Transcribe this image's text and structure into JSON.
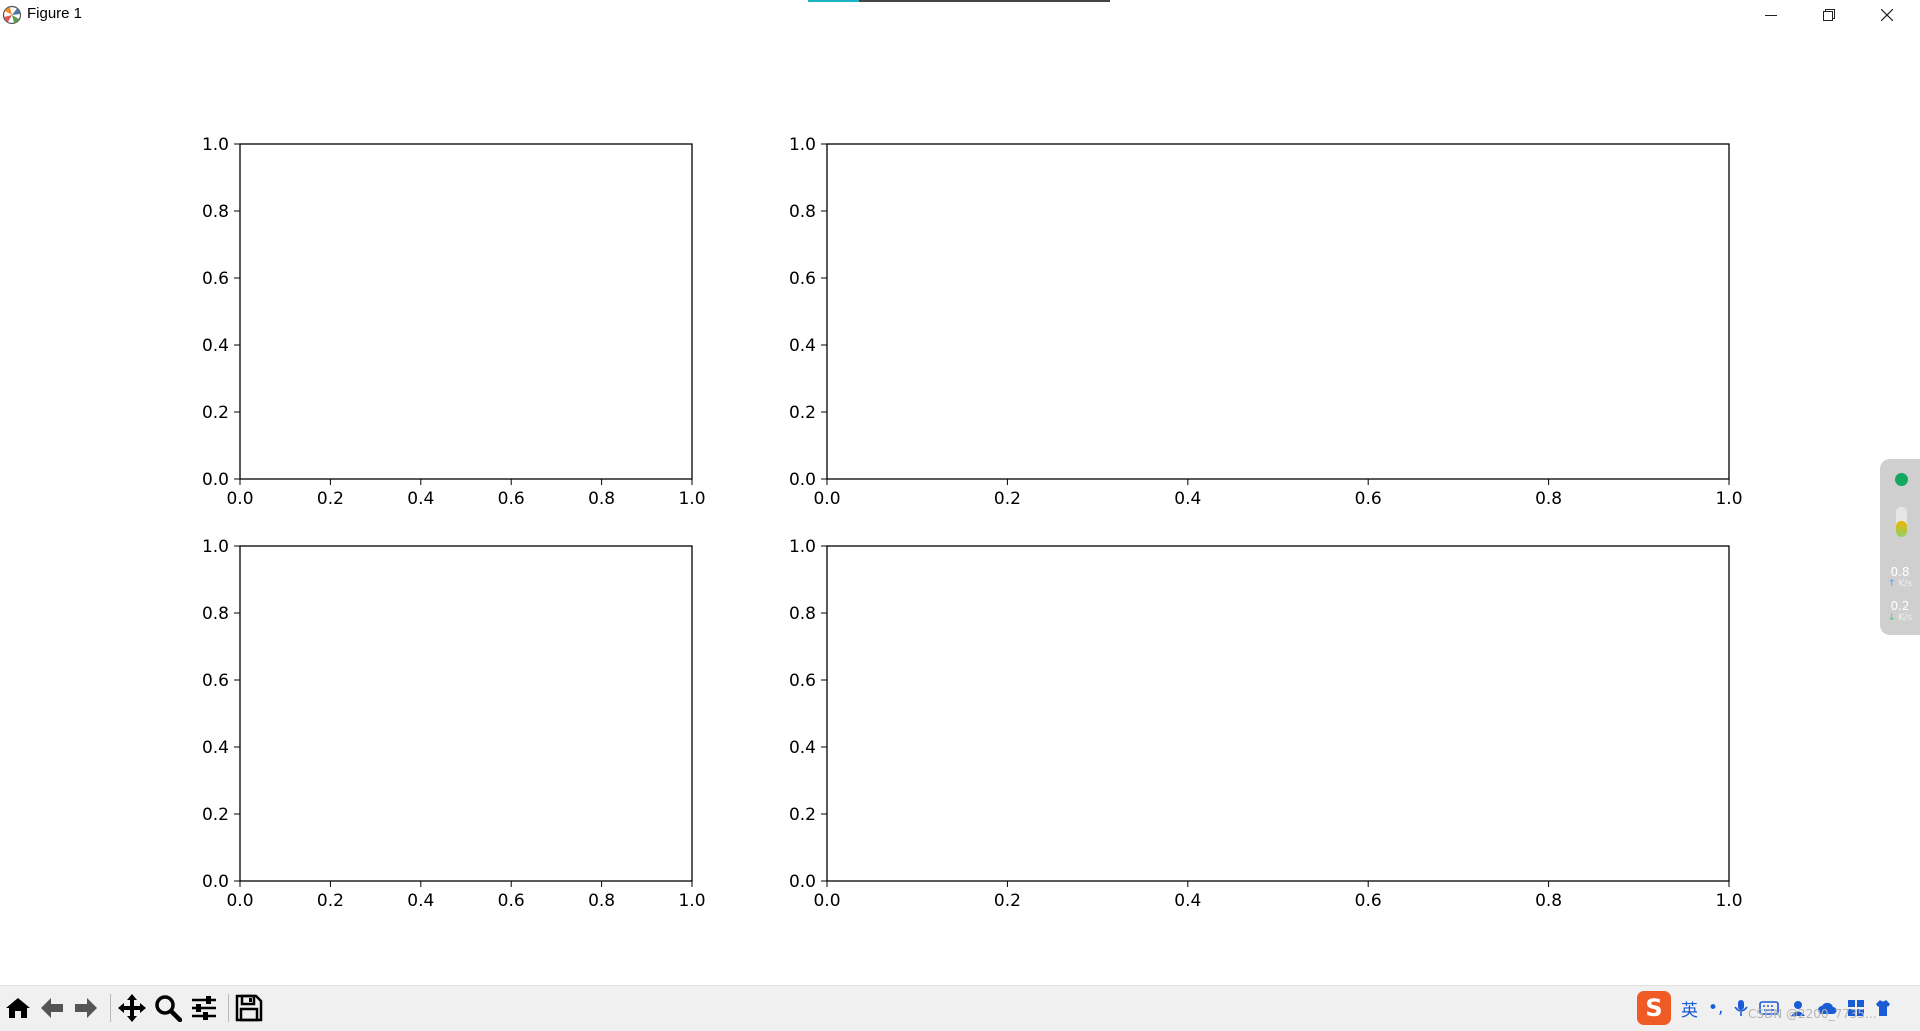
{
  "window": {
    "title": "Figure 1",
    "controls": {
      "minimize": "minimize",
      "maximize": "maximize",
      "close": "close"
    },
    "top_progress_fraction": 0.17
  },
  "toolbar": {
    "buttons": [
      {
        "name": "home",
        "icon": "home-icon"
      },
      {
        "name": "back",
        "icon": "arrow-left-icon"
      },
      {
        "name": "forward",
        "icon": "arrow-right-icon"
      },
      {
        "name": "pan",
        "icon": "move-icon"
      },
      {
        "name": "zoom",
        "icon": "magnifier-icon"
      },
      {
        "name": "configure-subplots",
        "icon": "sliders-icon"
      },
      {
        "name": "save",
        "icon": "floppy-disk-icon"
      }
    ]
  },
  "chart_data": [
    {
      "type": "line",
      "series": [],
      "xlim": [
        0,
        1
      ],
      "ylim": [
        0,
        1
      ],
      "xticks": [
        "0.0",
        "0.2",
        "0.4",
        "0.6",
        "0.8",
        "1.0"
      ],
      "yticks": [
        "0.0",
        "0.2",
        "0.4",
        "0.6",
        "0.8",
        "1.0"
      ],
      "grid": false
    },
    {
      "type": "line",
      "series": [],
      "xlim": [
        0,
        1
      ],
      "ylim": [
        0,
        1
      ],
      "xticks": [
        "0.0",
        "0.2",
        "0.4",
        "0.6",
        "0.8",
        "1.0"
      ],
      "yticks": [
        "0.0",
        "0.2",
        "0.4",
        "0.6",
        "0.8",
        "1.0"
      ],
      "grid": false
    },
    {
      "type": "line",
      "series": [],
      "xlim": [
        0,
        1
      ],
      "ylim": [
        0,
        1
      ],
      "xticks": [
        "0.0",
        "0.2",
        "0.4",
        "0.6",
        "0.8",
        "1.0"
      ],
      "yticks": [
        "0.0",
        "0.2",
        "0.4",
        "0.6",
        "0.8",
        "1.0"
      ],
      "grid": false
    },
    {
      "type": "line",
      "series": [],
      "xlim": [
        0,
        1
      ],
      "ylim": [
        0,
        1
      ],
      "xticks": [
        "0.0",
        "0.2",
        "0.4",
        "0.6",
        "0.8",
        "1.0"
      ],
      "yticks": [
        "0.0",
        "0.2",
        "0.4",
        "0.6",
        "0.8",
        "1.0"
      ],
      "grid": false
    }
  ],
  "net_widget": {
    "status_color": "#12a85f",
    "load_fraction": 0.55,
    "upload": {
      "value": "0.8",
      "unit": "K/s"
    },
    "download": {
      "value": "0.2",
      "unit": "K/s"
    }
  },
  "ime": {
    "logo": "S",
    "lang": "英",
    "punct": "•,"
  },
  "watermark": "CSDN @2200_7735..."
}
